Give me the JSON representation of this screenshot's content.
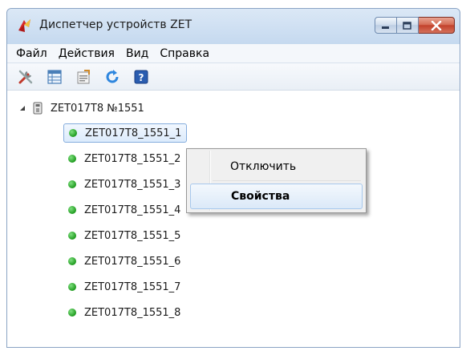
{
  "window": {
    "title": "Диспетчер устройств ZET"
  },
  "menu": {
    "items": [
      "Файл",
      "Действия",
      "Вид",
      "Справка"
    ]
  },
  "toolbar": {
    "buttons": [
      "tools-icon",
      "table-icon",
      "properties-icon",
      "refresh-icon",
      "help-icon"
    ],
    "help_glyph": "?"
  },
  "tree": {
    "root": "ZET017T8 №1551",
    "children": [
      "ZET017T8_1551_1",
      "ZET017T8_1551_2",
      "ZET017T8_1551_3",
      "ZET017T8_1551_4",
      "ZET017T8_1551_5",
      "ZET017T8_1551_6",
      "ZET017T8_1551_7",
      "ZET017T8_1551_8"
    ],
    "selected_index": 0
  },
  "context_menu": {
    "items": [
      "Отключить",
      "Свойства"
    ],
    "highlighted_index": 1
  },
  "colors": {
    "status_online": "#22aa22",
    "close_button": "#c2402a",
    "selection_border": "#84acdd"
  }
}
